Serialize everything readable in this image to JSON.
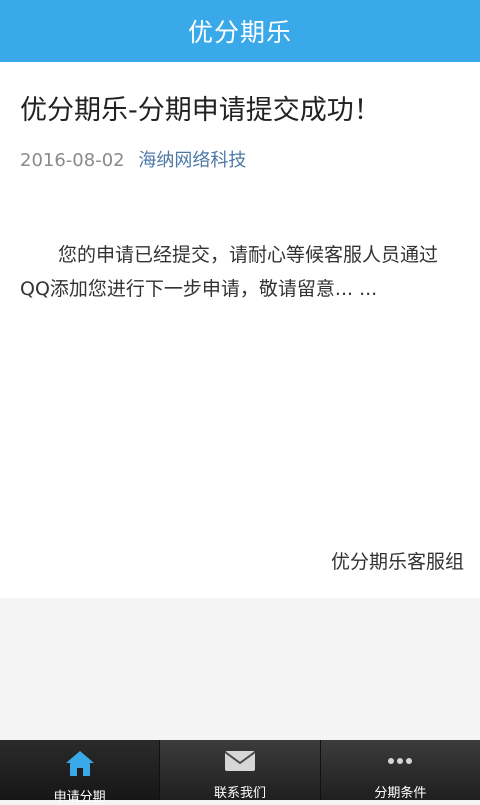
{
  "header": {
    "title": "优分期乐"
  },
  "article": {
    "title": "优分期乐-分期申请提交成功！",
    "date": "2016-08-02",
    "author": "海纳网络科技",
    "body": "您的申请已经提交，请耐心等候客服人员通过QQ添加您进行下一步申请，敬请留意... ...",
    "signature": "优分期乐客服组"
  },
  "tabbar": {
    "tabs": [
      {
        "label": "申请分期",
        "icon": "home-icon",
        "active": true
      },
      {
        "label": "联系我们",
        "icon": "mail-icon",
        "active": false
      },
      {
        "label": "分期条件",
        "icon": "more-icon",
        "active": false
      }
    ]
  },
  "colors": {
    "header_bg": "#3aa9ea",
    "author_link": "#4e79a6",
    "tabbar_bg": "#2a2a2a",
    "home_icon": "#3aa9ea"
  }
}
